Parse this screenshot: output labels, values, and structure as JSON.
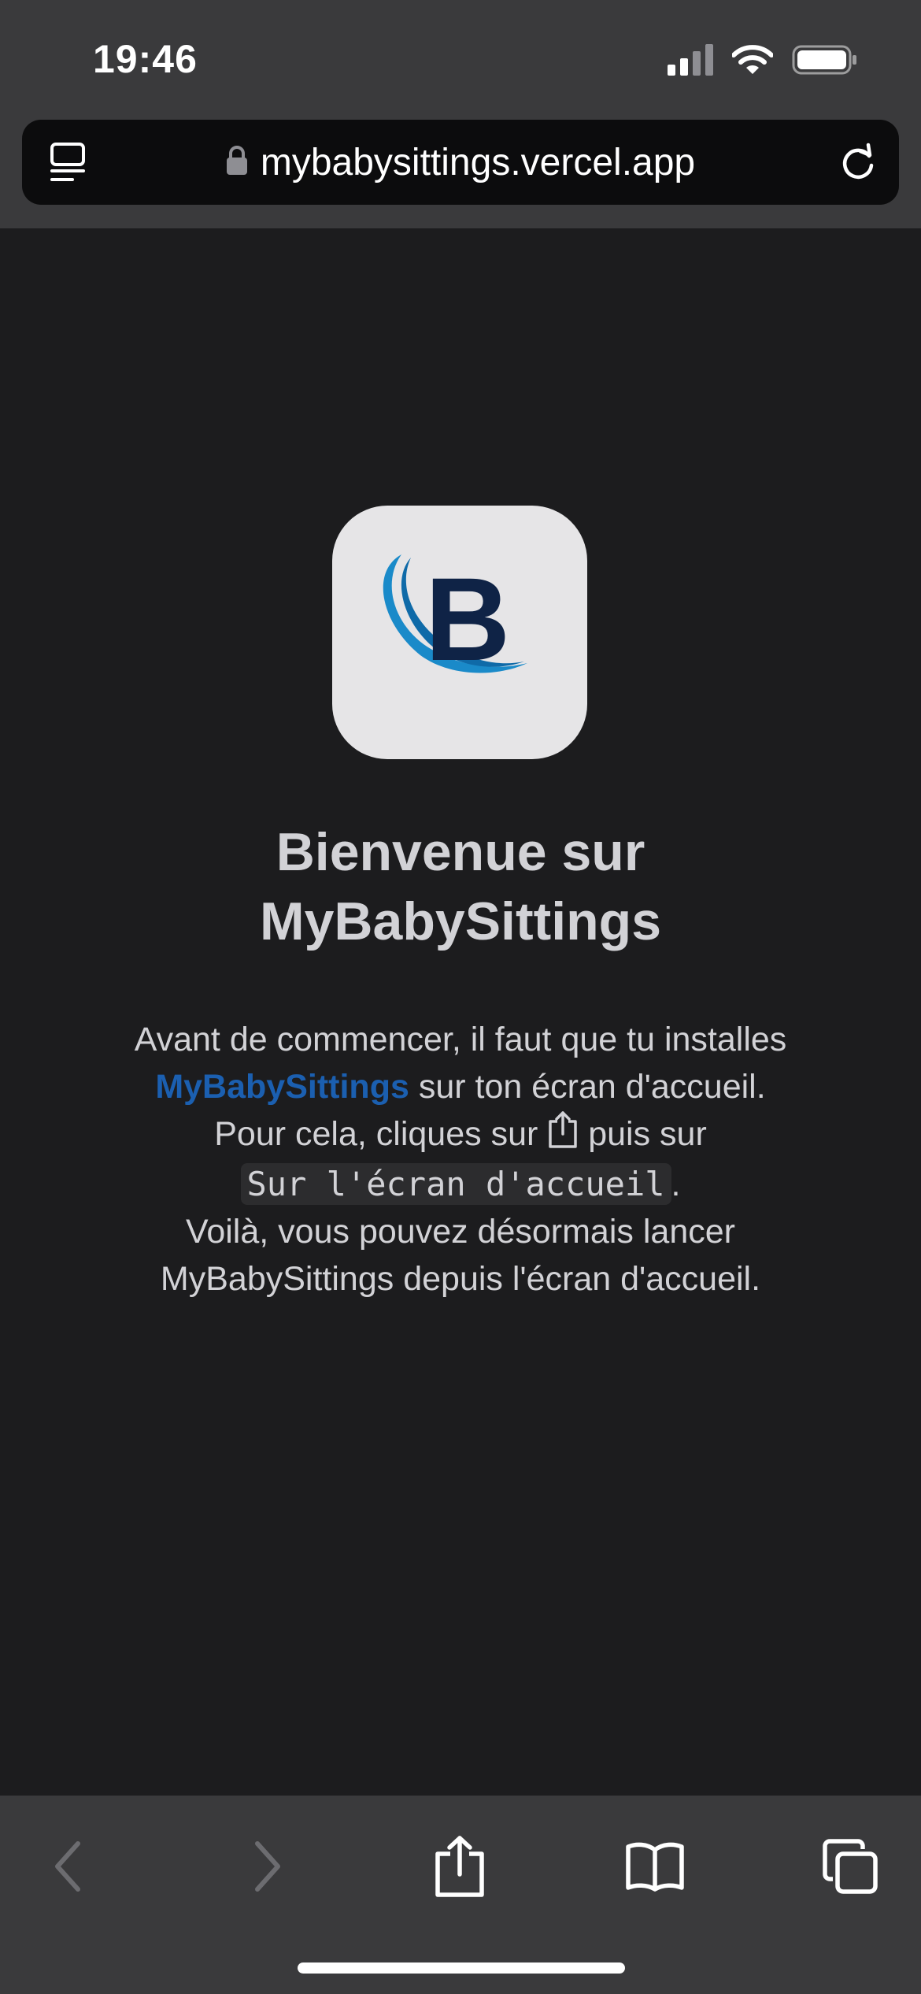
{
  "status": {
    "time": "19:46",
    "icons": [
      "signal-icon",
      "wifi-icon",
      "battery-icon"
    ]
  },
  "browser": {
    "url": "mybabysittings.vercel.app",
    "icons": [
      "reader-mode-icon",
      "lock-icon",
      "reload-icon"
    ]
  },
  "content": {
    "app_icon_letter": "B",
    "title_line1": "Bienvenue sur",
    "title_line2": "MyBabySittings",
    "instr_line1": "Avant de commencer, il faut que tu installes",
    "instr_app_name": "MyBabySittings",
    "instr_line2_rest": " sur ton écran d'accueil.",
    "instr_line3_start": "Pour cela, cliques sur ",
    "instr_line3_end": " puis sur",
    "instr_code": "Sur l'écran d'accueil",
    "instr_code_suffix": ".",
    "instr_line5": "Voilà, vous pouvez désormais lancer",
    "instr_line6": "MyBabySittings depuis l'écran d'accueil."
  },
  "toolbar": {
    "buttons": [
      "back-icon",
      "forward-icon",
      "share-icon",
      "bookmarks-icon",
      "tabs-icon"
    ]
  },
  "colors": {
    "background": "#1c1c1e",
    "chrome": "#3a3a3c",
    "accent": "#1b5fb0",
    "text": "#d2d2d6"
  }
}
